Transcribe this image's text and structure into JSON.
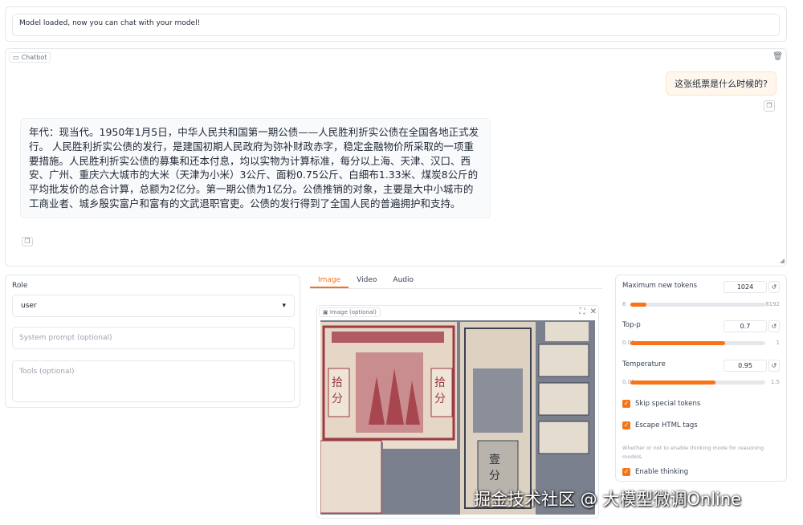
{
  "status": {
    "text": "Model loaded, now you can chat with your model!"
  },
  "chatbot": {
    "label": "Chatbot",
    "user_message": "这张纸票是什么时候的?",
    "bot_message": "年代：现当代。1950年1月5日，中华人民共和国第一期公债——人民胜利折实公债在全国各地正式发行。 人民胜利折实公债的发行，是建国初期人民政府为弥补财政赤字，稳定金融物价所采取的一项重要措施。人民胜利折实公债的募集和还本付息，均以实物为计算标准，每分以上海、天津、汉口、西安、广州、重庆六大城市的大米（天津为小米）3公斤、面粉0.75公斤、白细布1.33米、煤炭8公斤的平均批发价的总合计算，总额为2亿分。第一期公债为1亿分。公债推销的对象，主要是大中小城市的工商业者、城乡殷实富户和富有的文武退职官吏。公债的发行得到了全国人民的普遍拥护和支持。"
  },
  "left": {
    "role_label": "Role",
    "role_value": "user",
    "system_placeholder": "System prompt (optional)",
    "tools_placeholder": "Tools (optional)"
  },
  "tabs": [
    {
      "label": "Image",
      "active": true
    },
    {
      "label": "Video",
      "active": false
    },
    {
      "label": "Audio",
      "active": false
    }
  ],
  "image_box": {
    "label": "Image (optional)"
  },
  "params": {
    "max_tokens": {
      "label": "Maximum new tokens",
      "value": "1024",
      "min": "8",
      "max": "8192",
      "fraction": 0.12
    },
    "top_p": {
      "label": "Top-p",
      "value": "0.7",
      "min": "0.01",
      "max": "1",
      "fraction": 0.7
    },
    "temperature": {
      "label": "Temperature",
      "value": "0.95",
      "min": "0.01",
      "max": "1.5",
      "fraction": 0.63
    },
    "skip_special": {
      "label": "Skip special tokens",
      "checked": true
    },
    "escape_html": {
      "label": "Escape HTML tags",
      "checked": true
    },
    "hint": "Whether or not to enable thinking mode for reasoning models.",
    "enable_thinking": {
      "label": "Enable thinking",
      "checked": true
    }
  },
  "watermark": "掘金技术社区 @ 大模型微调Online",
  "colors": {
    "accent": "#f97316",
    "user_bubble": "#fff7ed"
  }
}
